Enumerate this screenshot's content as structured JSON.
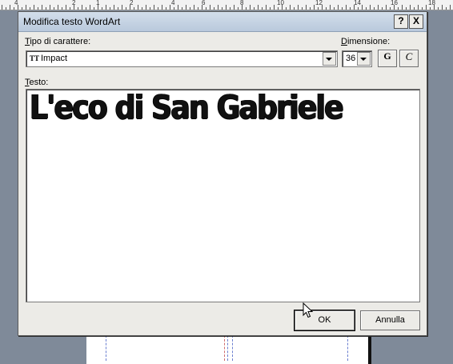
{
  "background": {
    "ruler_numbers": [
      "4",
      "2",
      "1",
      "2",
      "4",
      "6",
      "8",
      "10",
      "12",
      "14",
      "16",
      "18"
    ]
  },
  "dialog": {
    "title": "Modifica testo WordArt",
    "help_label": "?",
    "close_label": "X",
    "font": {
      "label_first": "T",
      "label_rest": "ipo di carattere:",
      "icon_glyph": "TT",
      "value": "Impact"
    },
    "size": {
      "label_first": "D",
      "label_rest": "imensione:",
      "value": "36"
    },
    "bold_label": "G",
    "italic_label": "C",
    "text": {
      "label_first": "T",
      "label_rest": "esto:",
      "value": "L'eco di San Gabriele"
    },
    "ok_label": "OK",
    "cancel_label": "Annulla"
  }
}
